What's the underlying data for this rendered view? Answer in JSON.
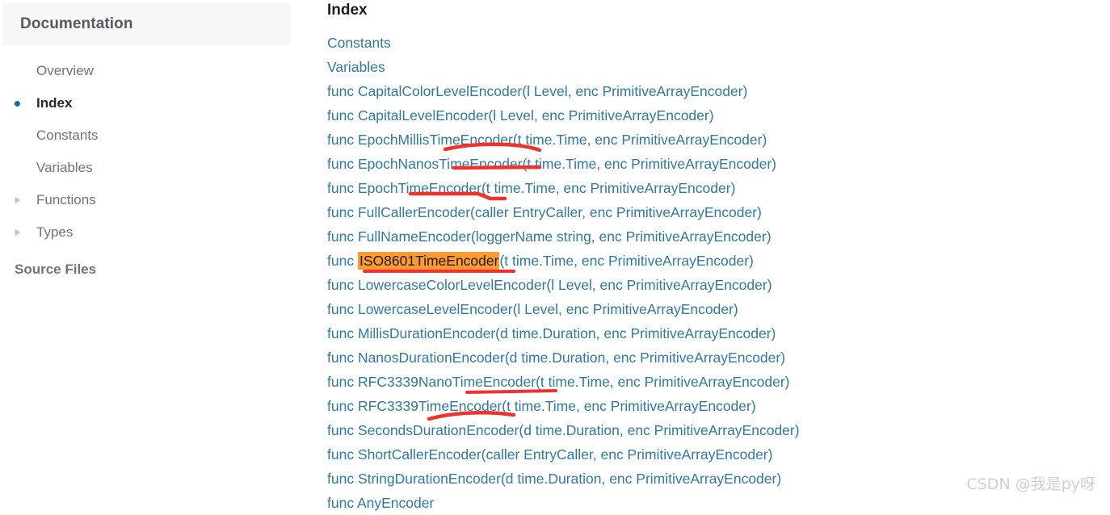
{
  "sidebar": {
    "header_title": "Documentation",
    "items": [
      {
        "label": "Overview",
        "marker": "none",
        "current": false
      },
      {
        "label": "Index",
        "marker": "bullet",
        "current": true
      },
      {
        "label": "Constants",
        "marker": "none",
        "current": false
      },
      {
        "label": "Variables",
        "marker": "none",
        "current": false
      },
      {
        "label": "Functions",
        "marker": "caret",
        "current": false
      },
      {
        "label": "Types",
        "marker": "caret",
        "current": false
      }
    ],
    "source_files_label": "Source Files"
  },
  "main": {
    "heading": "Index",
    "entries": [
      {
        "text": "Constants"
      },
      {
        "text": "Variables"
      },
      {
        "text": "func CapitalColorLevelEncoder(l Level, enc PrimitiveArrayEncoder)"
      },
      {
        "text": "func CapitalLevelEncoder(l Level, enc PrimitiveArrayEncoder)"
      },
      {
        "text": "func EpochMillisTimeEncoder(t time.Time, enc PrimitiveArrayEncoder)"
      },
      {
        "text": "func EpochNanosTimeEncoder(t time.Time, enc PrimitiveArrayEncoder)"
      },
      {
        "text": "func EpochTimeEncoder(t time.Time, enc PrimitiveArrayEncoder)"
      },
      {
        "text": "func FullCallerEncoder(caller EntryCaller, enc PrimitiveArrayEncoder)"
      },
      {
        "text": "func FullNameEncoder(loggerName string, enc PrimitiveArrayEncoder)"
      },
      {
        "prefix": "func ",
        "highlight": "ISO8601TimeEncoder",
        "suffix": "(t time.Time, enc PrimitiveArrayEncoder)"
      },
      {
        "text": "func LowercaseColorLevelEncoder(l Level, enc PrimitiveArrayEncoder)"
      },
      {
        "text": "func LowercaseLevelEncoder(l Level, enc PrimitiveArrayEncoder)"
      },
      {
        "text": "func MillisDurationEncoder(d time.Duration, enc PrimitiveArrayEncoder)"
      },
      {
        "text": "func NanosDurationEncoder(d time.Duration, enc PrimitiveArrayEncoder)"
      },
      {
        "text": "func RFC3339NanoTimeEncoder(t time.Time, enc PrimitiveArrayEncoder)"
      },
      {
        "text": "func RFC3339TimeEncoder(t time.Time, enc PrimitiveArrayEncoder)"
      },
      {
        "text": "func SecondsDurationEncoder(d time.Duration, enc PrimitiveArrayEncoder)"
      },
      {
        "text": "func ShortCallerEncoder(caller EntryCaller, enc PrimitiveArrayEncoder)"
      },
      {
        "text": "func StringDurationEncoder(d time.Duration, enc PrimitiveArrayEncoder)"
      },
      {
        "text": "func AnyEncoder"
      }
    ]
  },
  "watermark": {
    "text": "CSDN @我是py呀"
  },
  "colors": {
    "link": "#3079a3",
    "accent_bullet": "#11728c",
    "highlight_bg": "#ff9a33",
    "annotation_red": "#f0322e",
    "sidebar_header_bg": "#f7f7f7",
    "muted_text": "#6f7479",
    "watermark": "#cdd0d3"
  }
}
